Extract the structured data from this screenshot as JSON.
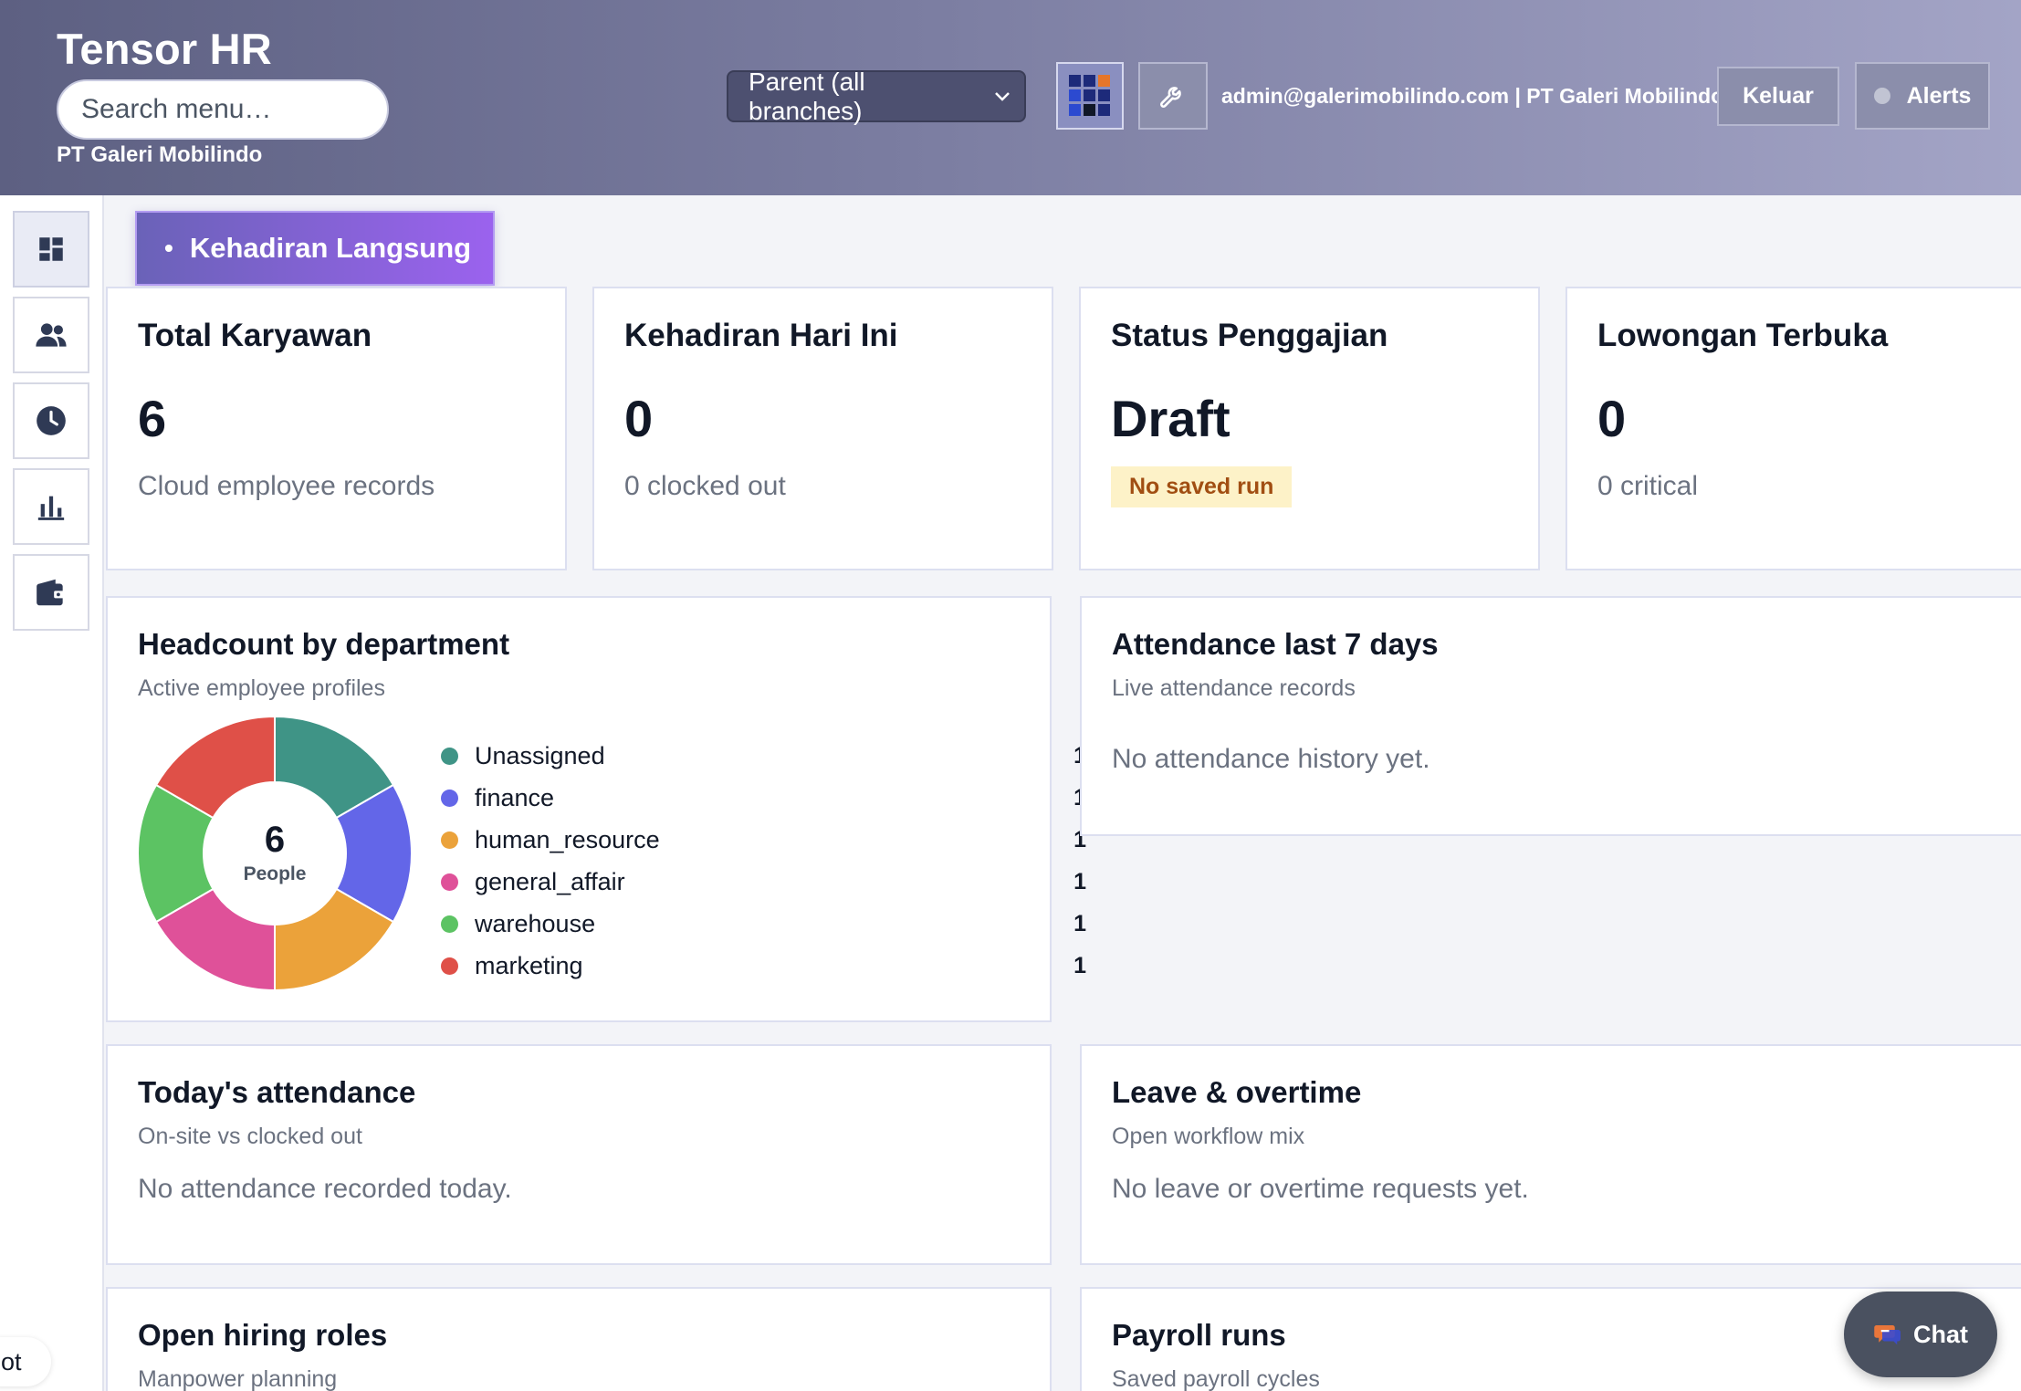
{
  "header": {
    "app_title": "Tensor HR",
    "search_placeholder": "Search menu…",
    "company": "PT Galeri Mobilindo",
    "branch_select": "Parent (all branches)",
    "user_info": "admin@galerimobilindo.com | PT Galeri Mobilindo",
    "logout_label": "Keluar",
    "alerts_label": "Alerts"
  },
  "sidebar": {
    "items": [
      {
        "icon": "dashboard-icon",
        "active": true
      },
      {
        "icon": "people-icon",
        "active": false
      },
      {
        "icon": "clock-icon",
        "active": false
      },
      {
        "icon": "bar-chart-icon",
        "active": false
      },
      {
        "icon": "wallet-icon",
        "active": false
      }
    ]
  },
  "live_button": {
    "label": "Kehadiran Langsung"
  },
  "stats": [
    {
      "title": "Total Karyawan",
      "value": "6",
      "sub": "Cloud employee records"
    },
    {
      "title": "Kehadiran Hari Ini",
      "value": "0",
      "sub": "0 clocked out"
    },
    {
      "title": "Status Penggajian",
      "value": "Draft",
      "badge": "No saved run"
    },
    {
      "title": "Lowongan Terbuka",
      "value": "0",
      "sub": "0 critical"
    }
  ],
  "headcount": {
    "title": "Headcount by department",
    "subtitle": "Active employee profiles",
    "center_value": "6",
    "center_label": "People",
    "chart_data": {
      "type": "pie",
      "categories": [
        "Unassigned",
        "finance",
        "human_resource",
        "general_affair",
        "warehouse",
        "marketing"
      ],
      "values": [
        1,
        1,
        1,
        1,
        1,
        1
      ],
      "colors": [
        "#3f9486",
        "#6366e8",
        "#eba23a",
        "#df5199",
        "#5cc363",
        "#df5048"
      ]
    },
    "legend": [
      {
        "name": "Unassigned",
        "count": "1",
        "color": "#3f9486"
      },
      {
        "name": "finance",
        "count": "1",
        "color": "#6366e8"
      },
      {
        "name": "human_resource",
        "count": "1",
        "color": "#eba23a"
      },
      {
        "name": "general_affair",
        "count": "1",
        "color": "#df5199"
      },
      {
        "name": "warehouse",
        "count": "1",
        "color": "#5cc363"
      },
      {
        "name": "marketing",
        "count": "1",
        "color": "#df5048"
      }
    ]
  },
  "attendance7": {
    "title": "Attendance last 7 days",
    "subtitle": "Live attendance records",
    "empty": "No attendance history yet."
  },
  "today_attendance": {
    "title": "Today's attendance",
    "subtitle": "On-site vs clocked out",
    "empty": "No attendance recorded today."
  },
  "leave_overtime": {
    "title": "Leave & overtime",
    "subtitle": "Open workflow mix",
    "empty": "No leave or overtime requests yet."
  },
  "hiring": {
    "title": "Open hiring roles",
    "subtitle": "Manpower planning"
  },
  "payroll": {
    "title": "Payroll runs",
    "subtitle": "Saved payroll cycles"
  },
  "chat": {
    "label": "Chat"
  },
  "side_tab": {
    "label": "hot"
  },
  "colors": {
    "accent_start": "#6a62b8",
    "accent_end": "#9b62ee",
    "badge_bg": "#fdf2c8",
    "badge_text": "#a14e12"
  }
}
